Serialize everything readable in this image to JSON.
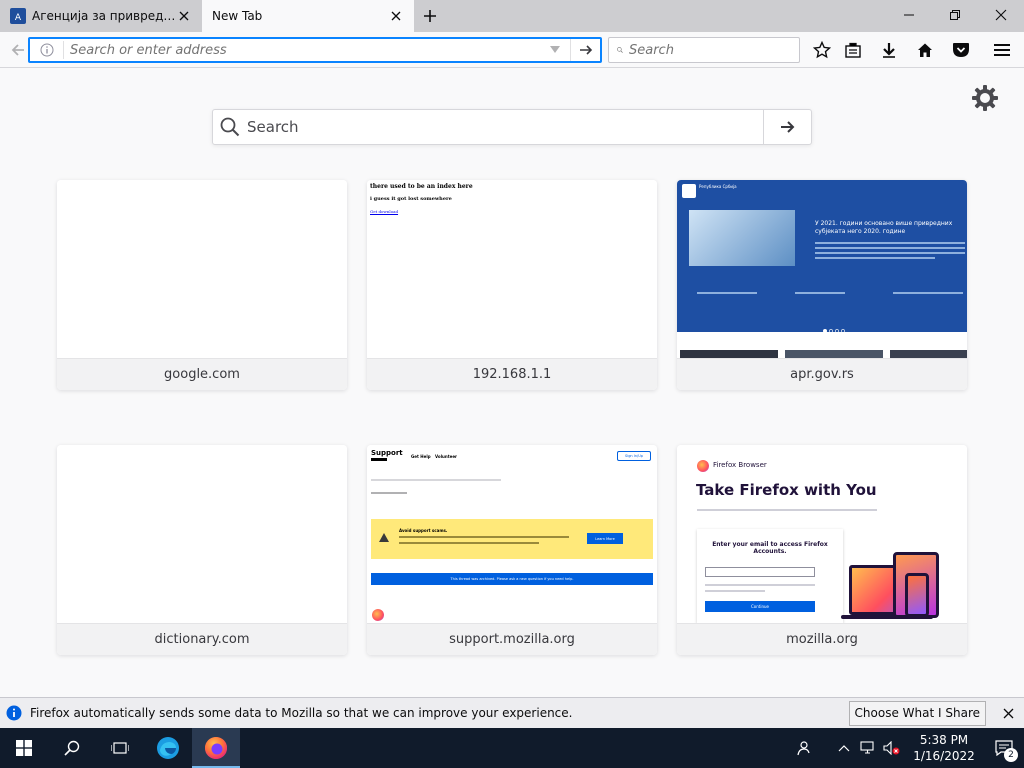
{
  "tabs": [
    {
      "title": "Агенција за привредне р…",
      "active": false
    },
    {
      "title": "New Tab",
      "active": true
    }
  ],
  "navbar": {
    "url_placeholder": "Search or enter address",
    "search_placeholder": "Search"
  },
  "page": {
    "search_placeholder": "Search",
    "tiles": [
      {
        "label": "google.com"
      },
      {
        "label": "192.168.1.1",
        "shot_line1": "there used to be an index here",
        "shot_line2": "i guess it got lost somewhere",
        "shot_link": "Get download"
      },
      {
        "label": "apr.gov.rs",
        "shot_heading": "У 2021. години основано више привредних субјеката него 2020. године",
        "shot_org": "Република Србија"
      },
      {
        "label": "dictionary.com"
      },
      {
        "label": "support.mozilla.org",
        "shot_title": "Support",
        "shot_nav1": "Get Help",
        "shot_nav2": "Volunteer",
        "shot_btn": "Sign In/Up",
        "shot_warning": "Avoid support scams.",
        "shot_learn": "Learn More",
        "shot_archive": "This thread was archived. Please ask a new question if you need help."
      },
      {
        "label": "mozilla.org",
        "shot_brand": "Firefox Browser",
        "shot_headline": "Take Firefox with You",
        "shot_form_title": "Enter your email to access Firefox Accounts.",
        "shot_continue": "Continue"
      }
    ]
  },
  "notification": {
    "text": "Firefox automatically sends some data to Mozilla so that we can improve your experience.",
    "button": "Choose What I Share"
  },
  "taskbar": {
    "time": "5:38 PM",
    "date": "1/16/2022",
    "notifications_count": "2"
  },
  "colors": {
    "accent": "#0a84ff",
    "taskbar": "#101b2b"
  }
}
